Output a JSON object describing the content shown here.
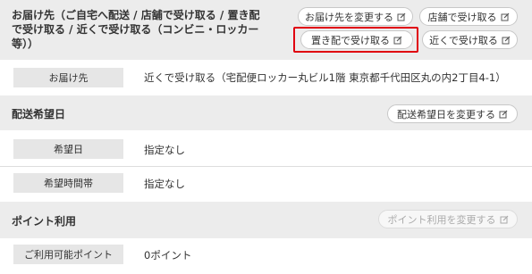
{
  "delivery": {
    "title": "お届け先（ご自宅へ配送 / 店舗で受け取る / 置き配で受け取る / 近くで受け取る（コンビニ・ロッカー等））",
    "title_lines": [
      "お届け先（ご自宅へ配送 / 店舗で受け取る / 置き配",
      "で受け取る / 近くで受け取る（コンビニ・ロッカー",
      "等））"
    ],
    "buttons": {
      "change_address": "お届け先を変更する",
      "store_pickup": "店舗で受け取る",
      "okihai": "置き配で受け取る",
      "nearby_pickup": "近くで受け取る"
    },
    "row": {
      "label": "お届け先",
      "value": "近くで受け取る（宅配便ロッカー丸ビル1階 東京都千代田区丸の内2丁目4-1）"
    }
  },
  "schedule": {
    "title": "配送希望日",
    "change_button": "配送希望日を変更する",
    "rows": [
      {
        "label": "希望日",
        "value": "指定なし"
      },
      {
        "label": "希望時間帯",
        "value": "指定なし"
      }
    ]
  },
  "points": {
    "title": "ポイント利用",
    "change_button": "ポイント利用を変更する",
    "row": {
      "label": "ご利用可能ポイント",
      "value": "0ポイント"
    }
  },
  "colors": {
    "highlight": "#e0000f",
    "section_bg": "#ececec",
    "label_bg": "#e6e6e6"
  },
  "icons": {
    "edit": "edit-icon"
  }
}
